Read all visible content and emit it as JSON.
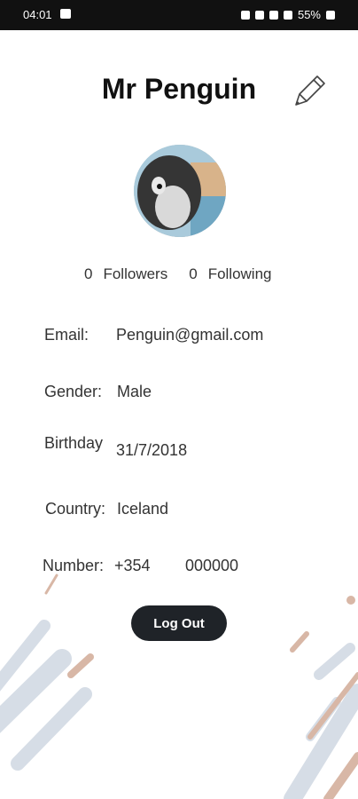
{
  "status_bar": {
    "time": "04:01",
    "battery": "55%"
  },
  "profile": {
    "name": "Mr Penguin",
    "followers_count": "0",
    "followers_label": "Followers",
    "following_count": "0",
    "following_label": "Following"
  },
  "fields": [
    {
      "label": "Email:",
      "value": "Penguin@gmail.com"
    },
    {
      "label": "Gender:",
      "value": "Male"
    },
    {
      "label": "Birthday",
      "value": "31/7/2018"
    },
    {
      "label": "Country:",
      "value": "Iceland"
    },
    {
      "label": "Number:",
      "code": "+354",
      "value": "000000"
    }
  ],
  "actions": {
    "logout_label": "Log Out"
  },
  "icons": {
    "edit": "pencil-icon",
    "avatar": "penguin-photo"
  },
  "colors": {
    "background": "#ffffff",
    "button": "#1f2328",
    "deco_gray": "#d6dde6",
    "deco_tan": "#d8b7a6"
  }
}
